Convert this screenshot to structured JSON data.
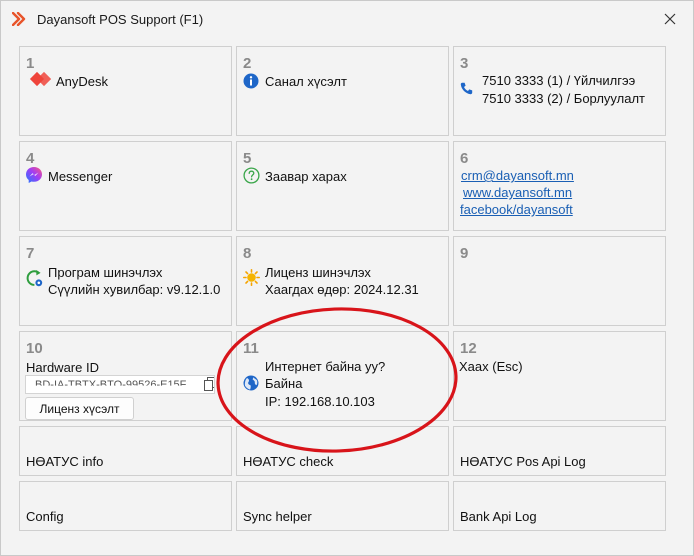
{
  "window": {
    "title": "Dayansoft POS Support (F1)",
    "accent": "#e03a2a"
  },
  "tiles": {
    "t1": {
      "num": "1",
      "label": "AnyDesk",
      "icon": "anydesk-icon"
    },
    "t2": {
      "num": "2",
      "label": "Санал хүсэлт",
      "icon": "info-icon"
    },
    "t3": {
      "num": "3",
      "line1": "7510 3333 (1) / Үйлчилгээ",
      "line2": "7510 3333 (2) / Борлуулалт",
      "icon": "phone-icon"
    },
    "t4": {
      "num": "4",
      "label": "Messenger",
      "icon": "messenger-icon"
    },
    "t5": {
      "num": "5",
      "label": "Заавар харах",
      "icon": "help-icon"
    },
    "t6": {
      "num": "6",
      "email": "crm@dayansoft.mn",
      "website": "www.dayansoft.mn",
      "facebook": "facebook/dayansoft"
    },
    "t7": {
      "num": "7",
      "line1": "Програм шинэчлэх",
      "line2": "Сүүлийн хувилбар: v9.12.1.0",
      "icon": "update-icon"
    },
    "t8": {
      "num": "8",
      "line1": "Лиценз шинэчлэх",
      "line2": "Хаагдах өдөр: 2024.12.31",
      "icon": "sun-icon"
    },
    "t9": {
      "num": "9"
    },
    "t10": {
      "num": "10",
      "label": "Hardware ID",
      "hwid": "BD-IA-TBTX-BTO-99526-E15F",
      "button": "Лиценз хүсэлт"
    },
    "t11": {
      "num": "11",
      "line1": "Интернет байна уу?",
      "line2": "Байна",
      "line3": "IP: 192.168.10.103",
      "icon": "globe-icon"
    },
    "t12": {
      "num": "12",
      "label": "Хаах (Esc)"
    },
    "t13": {
      "label": "НӨАТУС info"
    },
    "t14": {
      "label": "НӨАТУС check"
    },
    "t15": {
      "label": "НӨАТУС Pos Api Log"
    },
    "t16": {
      "label": "Config"
    },
    "t17": {
      "label": "Sync helper"
    },
    "t18": {
      "label": "Bank Api Log"
    }
  }
}
